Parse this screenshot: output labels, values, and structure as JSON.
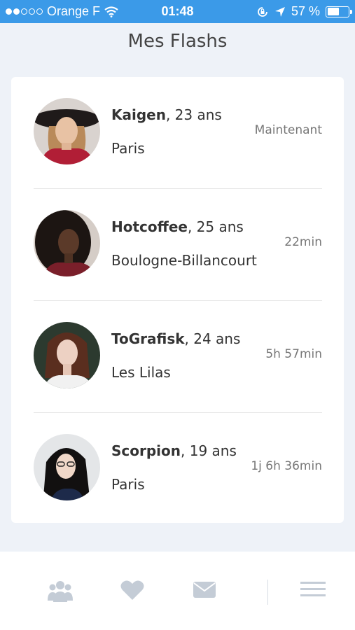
{
  "status_bar": {
    "carrier": "Orange F",
    "time": "01:48",
    "battery": "57 %",
    "battery_level": 0.57
  },
  "header": {
    "title": "Mes Flashs"
  },
  "flashes": [
    {
      "name": "Kaigen",
      "age": ", 23 ans",
      "city": "Paris",
      "time": "Maintenant"
    },
    {
      "name": "Hotcoffee",
      "age": ", 25 ans",
      "city": "Boulogne-Billancourt",
      "time": "22min"
    },
    {
      "name": "ToGrafisk",
      "age": ", 24 ans",
      "city": "Les Lilas",
      "time": "5h 57min"
    },
    {
      "name": "Scorpion",
      "age": ", 19 ans",
      "city": "Paris",
      "time": "1j 6h 36min"
    }
  ],
  "tabbar": {
    "icons": [
      "group-icon",
      "heart-icon",
      "mail-icon",
      "menu-icon"
    ],
    "icon_color": "#c4ccd6"
  },
  "colors": {
    "status_bar": "#3b9ae8",
    "background": "#eef2f8"
  }
}
